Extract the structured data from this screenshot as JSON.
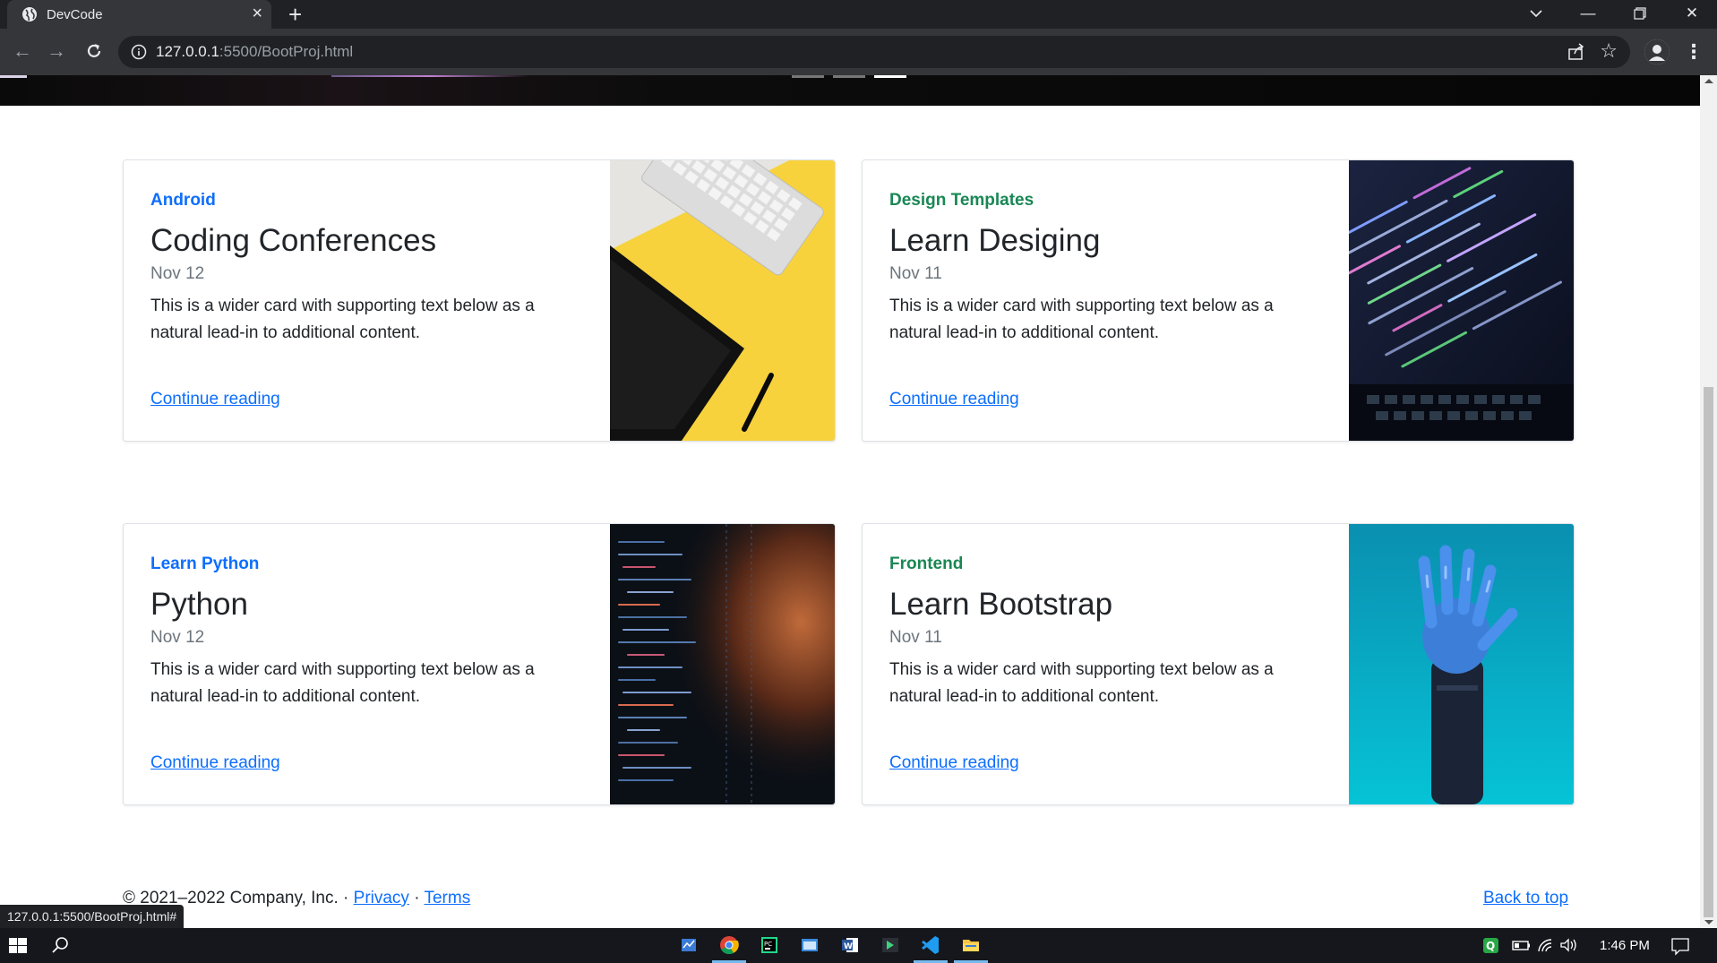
{
  "browser": {
    "tab_title": "DevCode",
    "url_host": "127.0.0.1",
    "url_path": ":5500/BootProj.html",
    "status_url": "127.0.0.1:5500/BootProj.html#"
  },
  "cards": [
    {
      "category": "Android",
      "category_color": "#0d6efd",
      "title": "Coding Conferences",
      "date": "Nov 12",
      "text": "This is a wider card with supporting text below as a natural lead-in to additional content.",
      "link": "Continue reading",
      "image": "keyboard-tablet-photo"
    },
    {
      "category": "Design Templates",
      "category_color": "#198754",
      "title": "Learn Desiging",
      "date": "Nov 11",
      "text": "This is a wider card with supporting text below as a natural lead-in to additional content.",
      "link": "Continue reading",
      "image": "laptop-code-photo"
    },
    {
      "category": "Learn Python",
      "category_color": "#0d6efd",
      "title": "Python",
      "date": "Nov 12",
      "text": "This is a wider card with supporting text below as a natural lead-in to additional content.",
      "link": "Continue reading",
      "image": "code-reflection-photo"
    },
    {
      "category": "Frontend",
      "category_color": "#198754",
      "title": "Learn Bootstrap",
      "date": "Nov 11",
      "text": "This is a wider card with supporting text below as a natural lead-in to additional content.",
      "link": "Continue reading",
      "image": "robot-hand-photo"
    }
  ],
  "footer": {
    "copyright": "© 2021–2022 Company, Inc. · ",
    "privacy": "Privacy",
    "separator": " · ",
    "terms": "Terms",
    "back_to_top": "Back to top"
  },
  "taskbar": {
    "time": "1:46 PM"
  }
}
